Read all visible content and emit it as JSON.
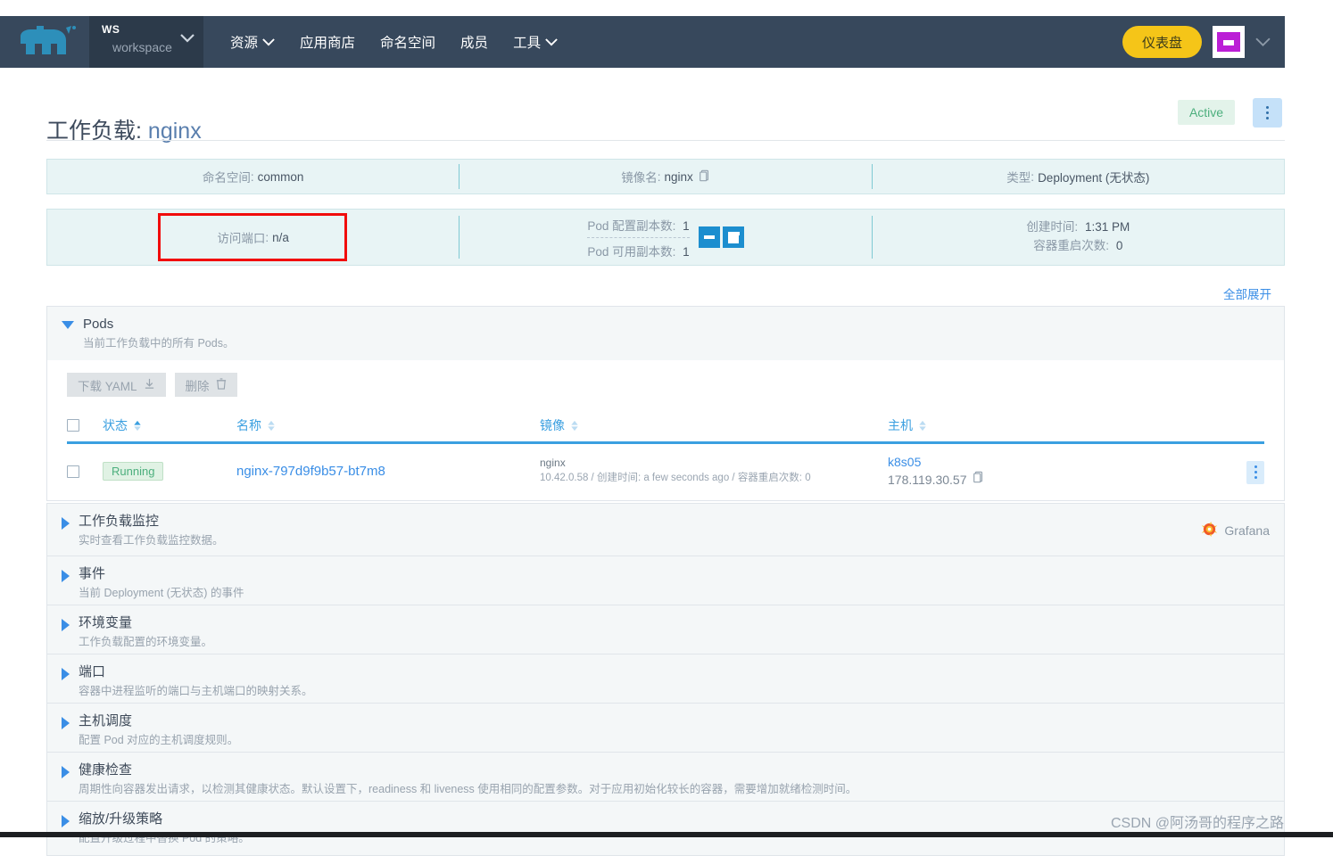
{
  "navbar": {
    "logo_name": "rancher-logo",
    "workspace": {
      "abbr": "WS",
      "name": "workspace"
    },
    "items": [
      {
        "label": "资源",
        "has_caret": true,
        "name": "nav-resources"
      },
      {
        "label": "应用商店",
        "has_caret": false,
        "name": "nav-app-store"
      },
      {
        "label": "命名空间",
        "has_caret": false,
        "name": "nav-namespace"
      },
      {
        "label": "成员",
        "has_caret": false,
        "name": "nav-members"
      },
      {
        "label": "工具",
        "has_caret": true,
        "name": "nav-tools"
      }
    ],
    "dashboard_button": "仪表盘",
    "bg_color": "#37485c",
    "dashboard_color": "#f5c518"
  },
  "page": {
    "title_prefix": "工作负载",
    "title_sep": ": ",
    "title_name": "nginx",
    "status": "Active",
    "status_color": "#4caf7d"
  },
  "info_row_1": [
    {
      "label": "命名空间",
      "value": "common",
      "copy": false
    },
    {
      "label": "镜像名",
      "value": "nginx",
      "copy": true
    },
    {
      "label": "类型",
      "value": "Deployment (无状态)",
      "copy": false
    }
  ],
  "info_row_2": {
    "access_port": {
      "label": "访问端口",
      "value": "n/a",
      "highlight_color": "#f10c0c"
    },
    "replicas": {
      "configured_label": "Pod 配置副本数",
      "configured_value": "1",
      "available_label": "Pod 可用副本数",
      "available_value": "1",
      "minus": "−",
      "plus": "+"
    },
    "created": {
      "created_label": "创建时间",
      "created_value": "1:31 PM",
      "restarts_label": "容器重启次数",
      "restarts_value": "0"
    }
  },
  "expand_all": "全部展开",
  "pods_panel": {
    "title": "Pods",
    "subtitle": "当前工作负载中的所有 Pods。",
    "expanded": true,
    "toolbar": [
      {
        "label": "下载 YAML",
        "icon": "download-icon",
        "name": "download-yaml-button"
      },
      {
        "label": "删除",
        "icon": "trash-icon",
        "name": "delete-button"
      }
    ],
    "columns": [
      {
        "label": "状态",
        "sortable": true
      },
      {
        "label": "名称",
        "sortable": true
      },
      {
        "label": "镜像",
        "sortable": true
      },
      {
        "label": "主机",
        "sortable": true
      }
    ],
    "rows": [
      {
        "status": "Running",
        "name": "nginx-797d9f9b57-bt7m8",
        "image_name": "nginx",
        "image_sub": "10.42.0.58 / 创建时间: a few seconds ago / 容器重启次数: 0",
        "host_name": "k8s05",
        "host_ip": "178.119.30.57"
      }
    ]
  },
  "sections": [
    {
      "title": "工作负载监控",
      "subtitle": "实时查看工作负载监控数据。",
      "badge": "Grafana",
      "name": "section-workload-monitoring"
    },
    {
      "title": "事件",
      "subtitle": "当前 Deployment (无状态) 的事件",
      "badge": "",
      "name": "section-events"
    },
    {
      "title": "环境变量",
      "subtitle": "工作负载配置的环境变量。",
      "badge": "",
      "name": "section-env-vars"
    },
    {
      "title": "端口",
      "subtitle": "容器中进程监听的端口与主机端口的映射关系。",
      "badge": "",
      "name": "section-ports"
    },
    {
      "title": "主机调度",
      "subtitle": "配置 Pod 对应的主机调度规则。",
      "badge": "",
      "name": "section-node-scheduling"
    },
    {
      "title": "健康检查",
      "subtitle": "周期性向容器发出请求，以检测其健康状态。默认设置下，readiness 和 liveness 使用相同的配置参数。对于应用初始化较长的容器，需要增加就绪检测时间。",
      "badge": "",
      "name": "section-health-check"
    },
    {
      "title": "缩放/升级策略",
      "subtitle": "配置升级过程中替换 Pod 的策略。",
      "badge": "",
      "name": "section-scaling-upgrade-policy"
    }
  ],
  "watermark": "CSDN @阿汤哥的程序之路"
}
